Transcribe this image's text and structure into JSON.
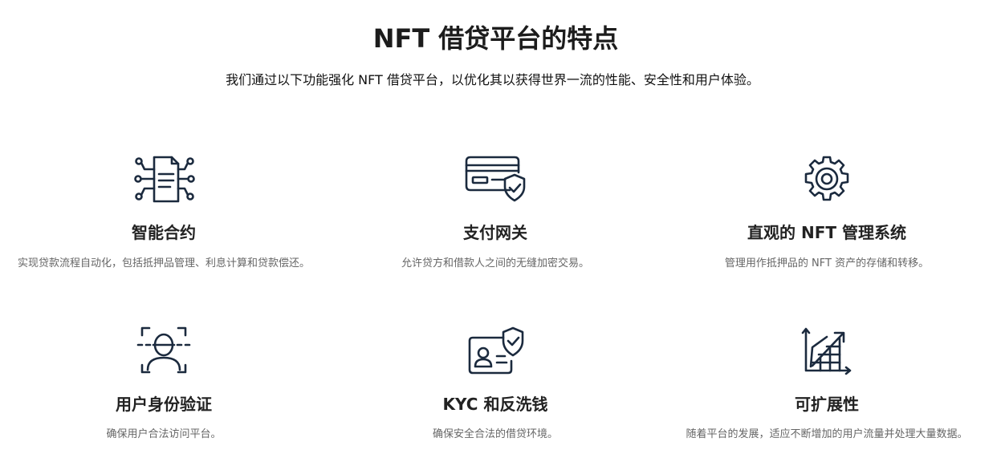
{
  "header": {
    "title": "NFT 借贷平台的特点",
    "subtitle": "我们通过以下功能强化 NFT 借贷平台，以优化其以获得世界一流的性能、安全性和用户体验。"
  },
  "features": [
    {
      "icon": "smart-contract-icon",
      "title": "智能合约",
      "description": "实现贷款流程自动化，包括抵押品管理、利息计算和贷款偿还。"
    },
    {
      "icon": "credit-card-shield-icon",
      "title": "支付网关",
      "description": "允许贷方和借款人之间的无缝加密交易。"
    },
    {
      "icon": "gear-icon",
      "title": "直观的 NFT 管理系统",
      "description": "管理用作抵押品的 NFT 资产的存储和转移。"
    },
    {
      "icon": "face-scan-icon",
      "title": "用户身份验证",
      "description": "确保用户合法访问平台。"
    },
    {
      "icon": "id-card-shield-icon",
      "title": "KYC 和反洗钱",
      "description": "确保安全合法的借贷环境。"
    },
    {
      "icon": "growth-chart-icon",
      "title": "可扩展性",
      "description": "随着平台的发展，适应不断增加的用户流量并处理大量数据。"
    }
  ],
  "colors": {
    "icon_stroke": "#1b2a3e",
    "title_text": "#222222",
    "description_text": "#666666"
  }
}
